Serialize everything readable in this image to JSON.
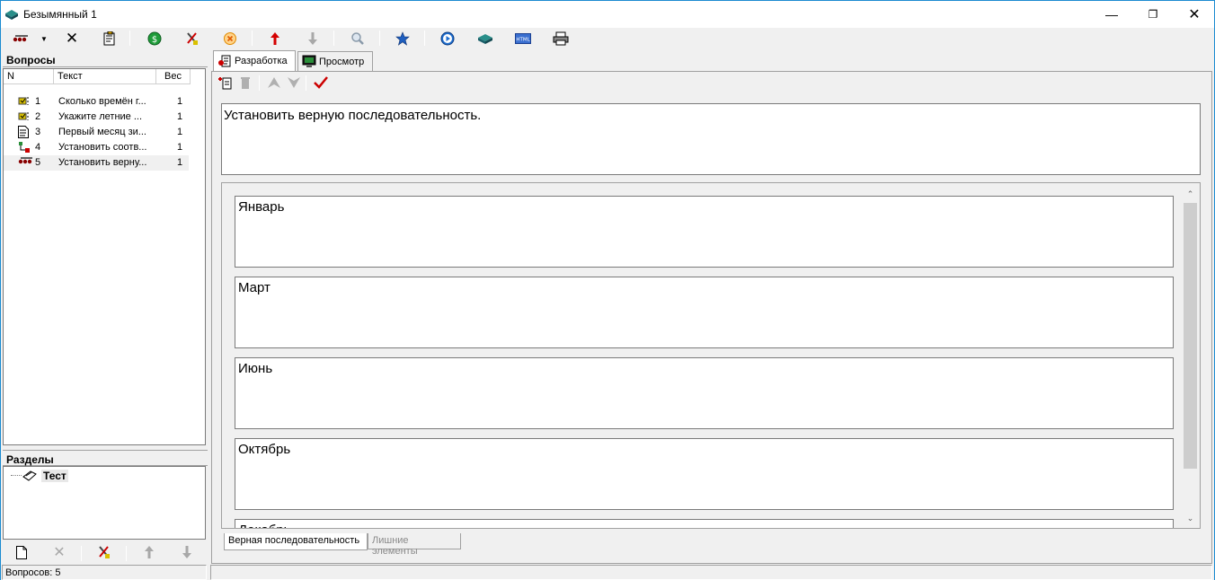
{
  "window": {
    "title": "Безымянный 1"
  },
  "toolbar": {
    "icons": [
      "order-icon",
      "dropdown-icon",
      "delete-icon",
      "properties-icon",
      "money-icon",
      "tools-icon",
      "cancel-icon",
      "up-red-icon",
      "down-gray-icon",
      "search-icon",
      "star-icon",
      "play-icon",
      "book-icon",
      "html-icon",
      "print-icon"
    ]
  },
  "questions": {
    "title": "Вопросы",
    "columns": {
      "n": "N",
      "text": "Текст",
      "weight": "Вес"
    },
    "rows": [
      {
        "n": "1",
        "text": "Сколько времён г...",
        "weight": "1",
        "icon": "single-choice-icon"
      },
      {
        "n": "2",
        "text": "Укажите летние ...",
        "weight": "1",
        "icon": "multi-choice-icon"
      },
      {
        "n": "3",
        "text": "Первый месяц зи...",
        "weight": "1",
        "icon": "text-doc-icon"
      },
      {
        "n": "4",
        "text": "Установить соотв...",
        "weight": "1",
        "icon": "match-icon"
      },
      {
        "n": "5",
        "text": "Установить верну...",
        "weight": "1",
        "icon": "order-icon"
      }
    ]
  },
  "sections": {
    "title": "Разделы",
    "items": [
      {
        "label": "Тест"
      }
    ]
  },
  "tabs": {
    "dev": "Разработка",
    "preview": "Просмотр"
  },
  "editor": {
    "question_text": "Установить верную последовательность.",
    "answers": [
      "Январь",
      "Март",
      "Июнь",
      "Октябрь",
      "Декабрь"
    ]
  },
  "bottom_tabs": {
    "correct": "Верная последовательность",
    "extra": "Лишние элементы"
  },
  "status": {
    "count": "Вопросов: 5"
  }
}
